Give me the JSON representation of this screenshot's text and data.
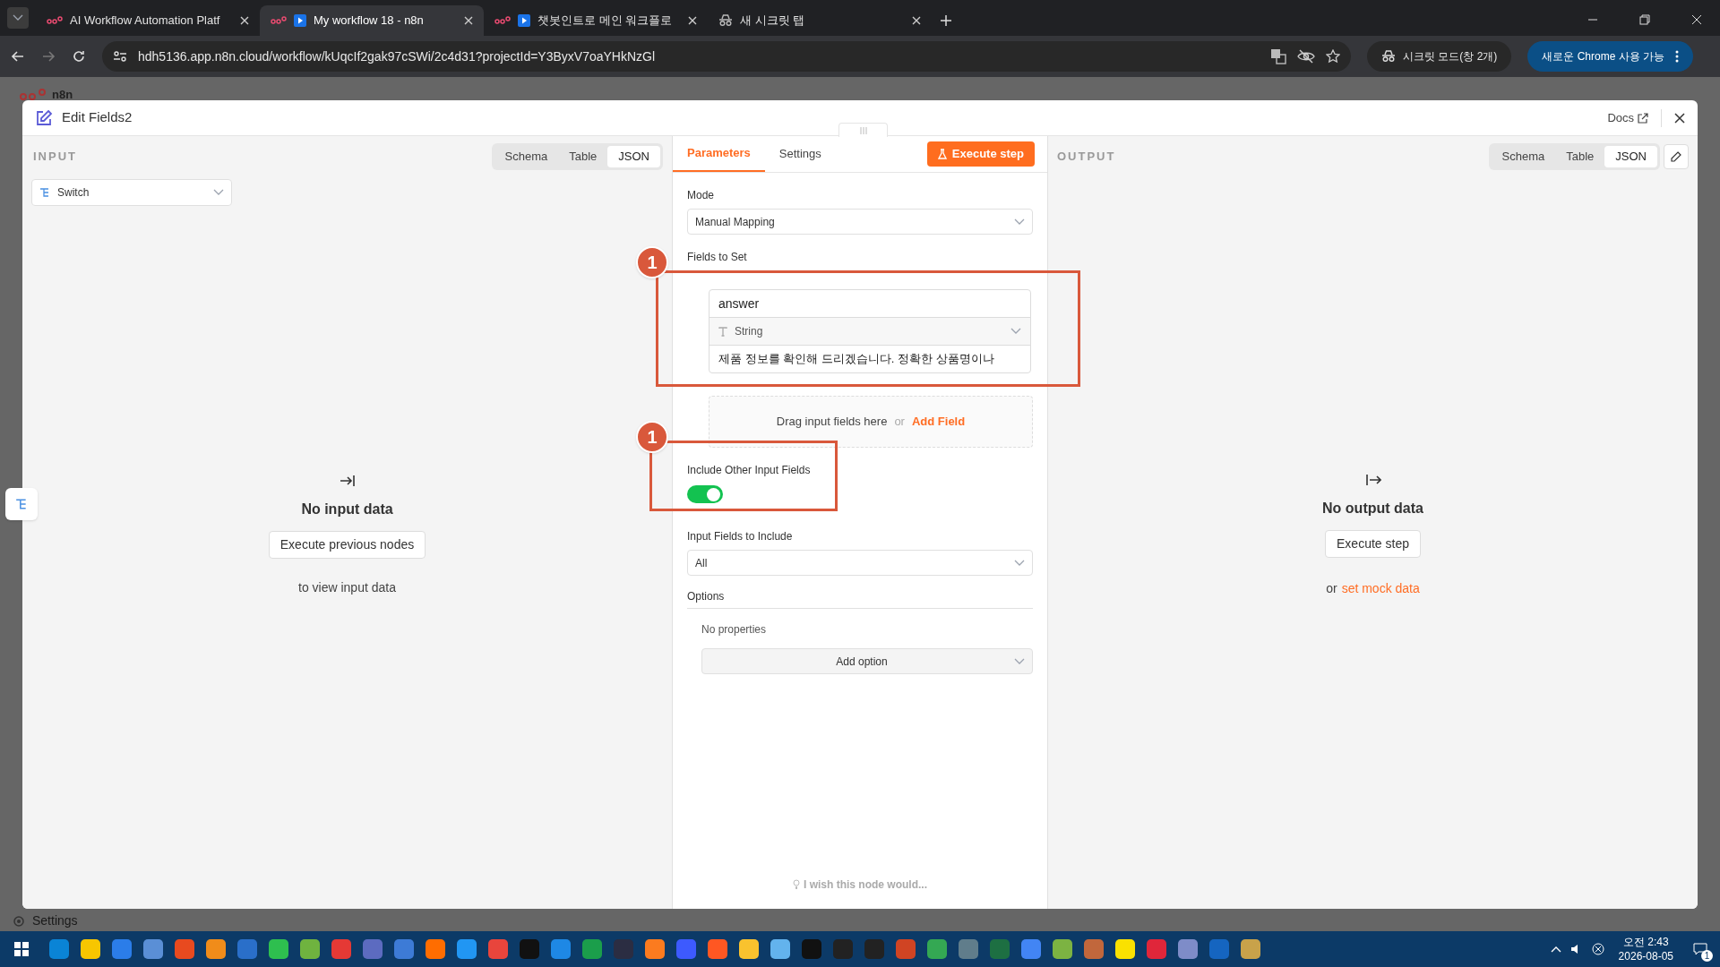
{
  "browser": {
    "tabs": [
      {
        "title": "AI Workflow Automation Platf",
        "selected": false,
        "kind": "logo"
      },
      {
        "title": "My workflow 18 - n8n",
        "selected": true,
        "kind": "play"
      },
      {
        "title": "챗봇인트로 메인 워크플로",
        "selected": false,
        "kind": "play"
      },
      {
        "title": "새 시크릿 탭",
        "selected": false,
        "kind": "incognito"
      }
    ],
    "url": "hdh5136.app.n8n.cloud/workflow/kUqcIf2gak97cSWi/2c4d31?projectId=Y3ByxV7oaYHkNzGl",
    "incognito_label": "시크릿 모드(창 2개)",
    "update_label": "새로운 Chrome 사용 가능"
  },
  "app_background": {
    "logo": "n8n",
    "settings": "Settings"
  },
  "modal": {
    "title": "Edit Fields2",
    "docs_label": "Docs"
  },
  "input_panel": {
    "heading": "INPUT",
    "view_tabs": [
      {
        "label": "Schema",
        "selected": false
      },
      {
        "label": "Table",
        "selected": false
      },
      {
        "label": "JSON",
        "selected": true
      }
    ],
    "node_select": "Switch",
    "empty_title": "No input data",
    "empty_button": "Execute previous nodes",
    "empty_hint": "to view input data"
  },
  "parameters_panel": {
    "tabs": [
      {
        "label": "Parameters",
        "selected": true
      },
      {
        "label": "Settings",
        "selected": false
      }
    ],
    "execute_button": "Execute step",
    "mode": {
      "label": "Mode",
      "value": "Manual Mapping"
    },
    "fields_to_set": {
      "label": "Fields to Set",
      "fields": [
        {
          "name": "answer",
          "type": "String",
          "value": "제품 정보를 확인해 드리겠습니다. 정확한 상품명이나"
        }
      ]
    },
    "drop_zone": {
      "text": "Drag input fields here",
      "or": "or",
      "link": "Add Field"
    },
    "include_other": {
      "label": "Include Other Input Fields",
      "on": true
    },
    "input_fields_to_include": {
      "label": "Input Fields to Include",
      "value": "All"
    },
    "options": {
      "label": "Options",
      "empty": "No properties",
      "add_button": "Add option"
    },
    "feedback": "I wish this node would..."
  },
  "output_panel": {
    "heading": "OUTPUT",
    "view_tabs": [
      {
        "label": "Schema",
        "selected": false
      },
      {
        "label": "Table",
        "selected": false
      },
      {
        "label": "JSON",
        "selected": true
      }
    ],
    "empty_title": "No output data",
    "empty_button": "Execute step",
    "empty_or": "or",
    "empty_link": "set mock data"
  },
  "annotations": [
    {
      "number": "1"
    },
    {
      "number": "1"
    }
  ],
  "taskbar": {
    "time": "오전 2:43",
    "date": "2026-08-05",
    "notification_count": "1"
  }
}
